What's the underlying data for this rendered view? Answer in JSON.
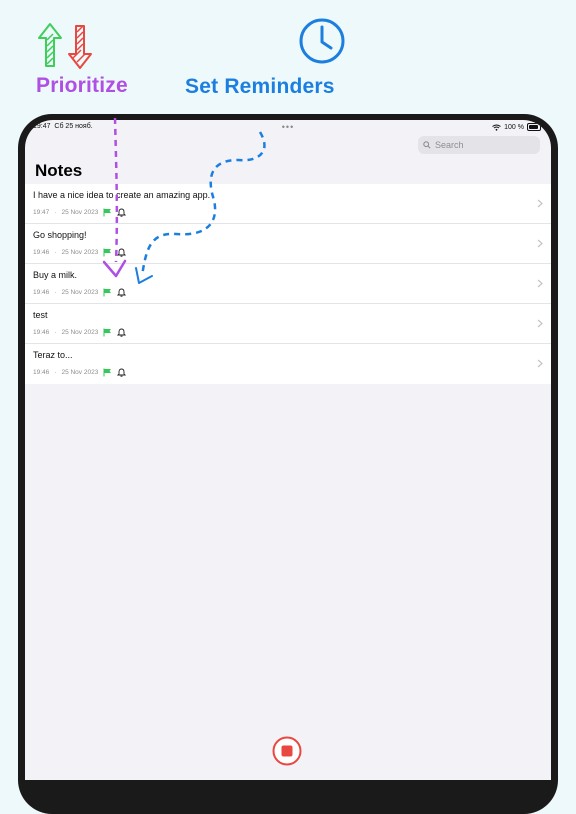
{
  "promo": {
    "prioritize_label": "Prioritize",
    "reminders_label": "Set Reminders",
    "colors": {
      "purple": "#b04fe3",
      "blue": "#1c7fe0",
      "green": "#3fce5a",
      "red": "#e8483f"
    }
  },
  "status_bar": {
    "time": "19:47",
    "date": "Сб 25 нояб.",
    "battery": "100 %"
  },
  "search": {
    "placeholder": "Search"
  },
  "page_title": "Notes",
  "notes": [
    {
      "title": "I have a nice idea to create an amazing app.",
      "time": "19:47",
      "date": "25 Nov 2023",
      "flag_icon": "flag-icon",
      "bell_icon": "bell-icon"
    },
    {
      "title": "Go shopping!",
      "time": "19:46",
      "date": "25 Nov 2023",
      "flag_icon": "flag-icon",
      "bell_icon": "bell-icon"
    },
    {
      "title": "Buy a milk.",
      "time": "19:46",
      "date": "25 Nov 2023",
      "flag_icon": "flag-icon",
      "bell_icon": "bell-icon"
    },
    {
      "title": "test",
      "time": "19:46",
      "date": "25 Nov 2023",
      "flag_icon": "flag-icon",
      "bell_icon": "bell-icon"
    },
    {
      "title": "Teraz to...",
      "time": "19:46",
      "date": "25 Nov 2023",
      "flag_icon": "flag-icon",
      "bell_icon": "bell-icon"
    }
  ],
  "meta_separator": "·",
  "record_button": {
    "icon": "stop-icon",
    "color": "#e8483f"
  }
}
